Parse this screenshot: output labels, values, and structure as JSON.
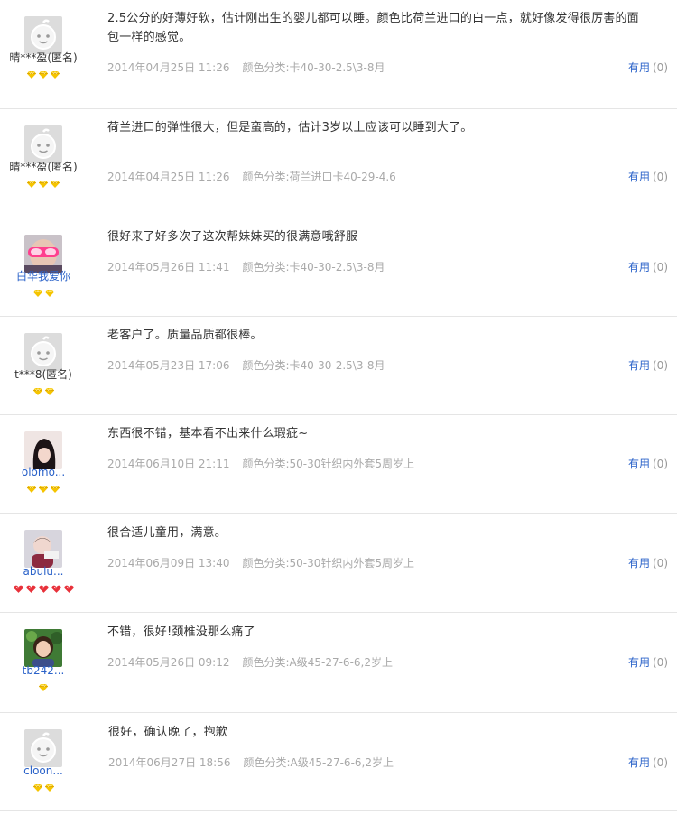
{
  "colors": {
    "link": "#2a62c9",
    "meta": "#a9a9a9",
    "divider": "#e5e5e5",
    "badge_gold": "#f5c400",
    "badge_red": "#e8313a"
  },
  "reviews": [
    {
      "user": "晴***盈(匿名)",
      "avatar": "default-avatar",
      "badge_type": "gold-diamond",
      "badge_count": 3,
      "content_line1": "2.5公分的好薄好软，估计刚出生的婴儿都可以睡。颜色比荷兰进口的白一点，就好像发得很厉害的面",
      "content_line2": "包一样的感觉。",
      "date": "2014年04月25日 11:26",
      "spec": "颜色分类:卡40-30-2.5\\3-8月",
      "useful_label": "有用",
      "useful_count": "(0)"
    },
    {
      "user": "晴***盈(匿名)",
      "avatar": "default-avatar",
      "badge_type": "gold-diamond",
      "badge_count": 3,
      "content_line1": "荷兰进口的弹性很大，但是蛮高的，估计3岁以上应该可以睡到大了。",
      "content_line2": "",
      "date": "2014年04月25日 11:26",
      "spec": "颜色分类:荷兰进口卡40-29-4.6",
      "useful_label": "有用",
      "useful_count": "(0)"
    },
    {
      "user": "白华我爱你",
      "avatar": "photo-pink-glasses",
      "badge_type": "gold-diamond",
      "badge_count": 2,
      "content_line1": "很好来了好多次了这次帮妹妹买的很满意哦舒服",
      "content_line2": "",
      "date": "2014年05月26日 11:41",
      "spec": "颜色分类:卡40-30-2.5\\3-8月",
      "useful_label": "有用",
      "useful_count": "(0)"
    },
    {
      "user": "t***8(匿名)",
      "avatar": "default-avatar",
      "badge_type": "gold-diamond",
      "badge_count": 2,
      "content_line1": "老客户了。质量品质都很棒。",
      "content_line2": "",
      "date": "2014年05月23日 17:06",
      "spec": "颜色分类:卡40-30-2.5\\3-8月",
      "useful_label": "有用",
      "useful_count": "(0)"
    },
    {
      "user": "olomo...",
      "avatar": "photo-dark-hair",
      "badge_type": "gold-diamond",
      "badge_count": 3,
      "content_line1": "东西很不错，基本看不出来什么瑕疵~",
      "content_line2": "",
      "date": "2014年06月10日 21:11",
      "spec": "颜色分类:50-30针织内外套5周岁上",
      "useful_label": "有用",
      "useful_count": "(0)"
    },
    {
      "user": "abulu...",
      "avatar": "photo-baby",
      "badge_type": "red-heart",
      "badge_count": 5,
      "content_line1": "很合适儿童用，满意。",
      "content_line2": "",
      "date": "2014年06月09日 13:40",
      "spec": "颜色分类:50-30针织内外套5周岁上",
      "useful_label": "有用",
      "useful_count": "(0)"
    },
    {
      "user": "tb242...",
      "avatar": "photo-woman",
      "badge_type": "gold-diamond",
      "badge_count": 1,
      "content_line1": "不错，很好!颈椎没那么痛了",
      "content_line2": "",
      "date": "2014年05月26日 09:12",
      "spec": "颜色分类:A级45-27-6-6,2岁上",
      "useful_label": "有用",
      "useful_count": "(0)"
    },
    {
      "user": "cloon...",
      "avatar": "default-avatar",
      "badge_type": "gold-diamond",
      "badge_count": 2,
      "content_line1": "很好，确认晚了，抱歉",
      "content_line2": "",
      "date": "2014年06月27日 18:56",
      "spec": "颜色分类:A级45-27-6-6,2岁上",
      "useful_label": "有用",
      "useful_count": "(0)"
    }
  ]
}
